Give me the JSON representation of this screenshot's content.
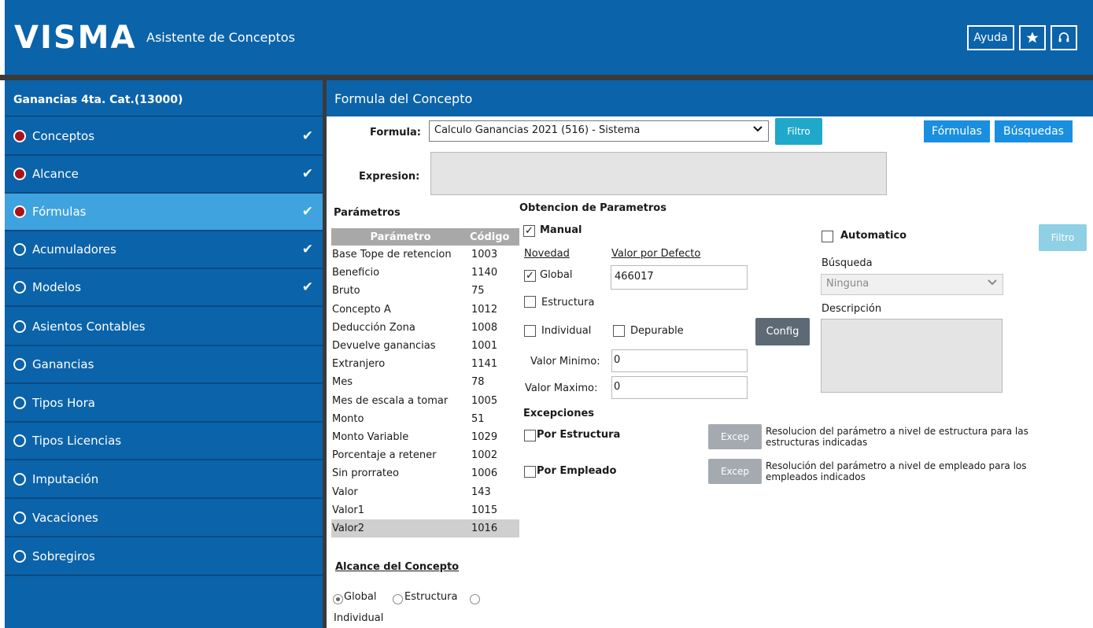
{
  "header": {
    "logo": "VISMA",
    "app_title": "Asistente de Conceptos",
    "help_label": "Ayuda",
    "favorite_icon": "star-icon",
    "support_icon": "headset-icon"
  },
  "sidebar": {
    "title": "Ganancias 4ta. Cat.(13000)",
    "items": [
      {
        "label": "Conceptos",
        "filled": true,
        "checked": true
      },
      {
        "label": "Alcance",
        "filled": true,
        "checked": true
      },
      {
        "label": "Fórmulas",
        "filled": true,
        "checked": true,
        "active": true
      },
      {
        "label": "Acumuladores",
        "filled": false,
        "checked": true
      },
      {
        "label": "Modelos",
        "filled": false,
        "checked": true
      },
      {
        "label": "Asientos Contables",
        "filled": false,
        "checked": false
      },
      {
        "label": "Ganancias",
        "filled": false,
        "checked": false
      },
      {
        "label": "Tipos Hora",
        "filled": false,
        "checked": false
      },
      {
        "label": "Tipos Licencias",
        "filled": false,
        "checked": false
      },
      {
        "label": "Imputación",
        "filled": false,
        "checked": false
      },
      {
        "label": "Vacaciones",
        "filled": false,
        "checked": false
      },
      {
        "label": "Sobregiros",
        "filled": false,
        "checked": false
      }
    ]
  },
  "main": {
    "title": "Formula del Concepto",
    "formula_label": "Formula:",
    "formula_value": "Calculo Ganancias 2021 (516) - Sistema",
    "filtro_label": "Filtro",
    "formulas_btn": "Fórmulas",
    "busquedas_btn": "Búsquedas",
    "expresion_label": "Expresion:",
    "parametros_title": "Parámetros",
    "table_headers": [
      "Parámetro",
      "Código"
    ],
    "parametros": [
      {
        "name": "Base Tope de retencion",
        "code": "1003"
      },
      {
        "name": "Beneficio",
        "code": "1140"
      },
      {
        "name": "Bruto",
        "code": "75"
      },
      {
        "name": "Concepto A",
        "code": "1012"
      },
      {
        "name": "Deducción Zona",
        "code": "1008"
      },
      {
        "name": "Devuelve ganancias",
        "code": "1001"
      },
      {
        "name": "Extranjero",
        "code": "1141"
      },
      {
        "name": "Mes",
        "code": "78"
      },
      {
        "name": "Mes de escala a tomar",
        "code": "1005"
      },
      {
        "name": "Monto",
        "code": "51"
      },
      {
        "name": "Monto Variable",
        "code": "1029"
      },
      {
        "name": "Porcentaje a retener",
        "code": "1002"
      },
      {
        "name": "Sin prorrateo",
        "code": "1006"
      },
      {
        "name": "Valor",
        "code": "143"
      },
      {
        "name": "Valor1",
        "code": "1015"
      },
      {
        "name": "Valor2",
        "code": "1016"
      }
    ],
    "selected_parametro": "Valor2",
    "obtencion_title": "Obtencion de Parametros",
    "manual_label": "Manual",
    "novedad_label": "Novedad",
    "valor_defecto_label": "Valor por Defecto",
    "global_label": "Global",
    "valor_defecto_value": "466017",
    "estructura_label": "Estructura",
    "individual_label": "Individual",
    "depurable_label": "Depurable",
    "config_btn": "Config",
    "valor_minimo_label": "Valor Minimo:",
    "valor_minimo_value": "0",
    "valor_maximo_label": "Valor Maximo:",
    "valor_maximo_value": "0",
    "automatico_label": "Automatico",
    "busqueda_label": "Búsqueda",
    "busqueda_value": "Ninguna",
    "descripcion_label": "Descripción",
    "excepciones_title": "Excepciones",
    "por_estructura_label": "Por Estructura",
    "por_empleado_label": "Por Empleado",
    "excep_btn": "Excep",
    "excep_estructura_desc_1": "Resolucion del parámetro a nivel de estructura para las",
    "excep_estructura_desc_2": "estructuras indicadas",
    "excep_empleado_desc_1": "Resolución del parámetro a nivel de empleado para los",
    "excep_empleado_desc_2": "empleados indicados",
    "alcance_title": "Alcance del Concepto",
    "alcance_global": "Global",
    "alcance_estructura": "Estructura",
    "alcance_individual": "Individual"
  },
  "colors": {
    "brand_blue": "#0b63aa",
    "active_item": "#3ea3de",
    "teal_button": "#1fa8c9",
    "status_red": "#a8121a"
  }
}
